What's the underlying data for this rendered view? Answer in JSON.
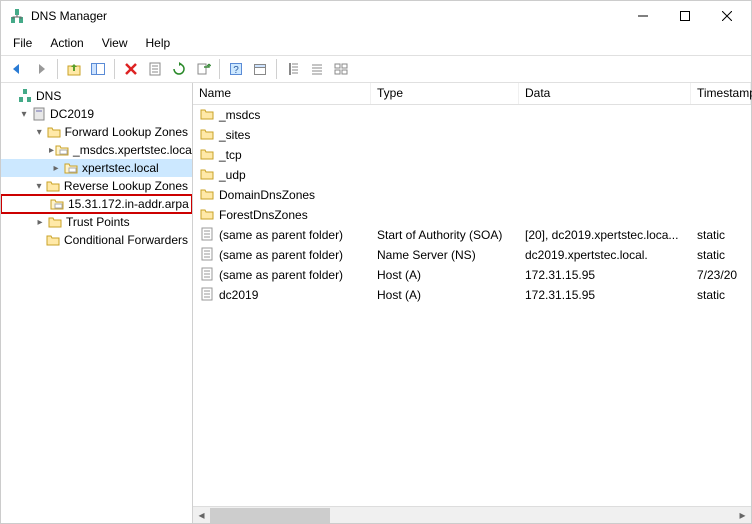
{
  "window": {
    "title": "DNS Manager"
  },
  "menu": {
    "file": "File",
    "action": "Action",
    "view": "View",
    "help": "Help"
  },
  "tree": {
    "root": "DNS",
    "server": "DC2019",
    "flz": "Forward Lookup Zones",
    "flz_child1": "_msdcs.xpertstec.local",
    "flz_child2": "xpertstec.local",
    "rlz": "Reverse Lookup Zones",
    "rlz_child1": "15.31.172.in-addr.arpa",
    "tp": "Trust Points",
    "cf": "Conditional Forwarders"
  },
  "columns": {
    "name": "Name",
    "type": "Type",
    "data": "Data",
    "ts": "Timestamp"
  },
  "rows": [
    {
      "name": "_msdcs",
      "type": "",
      "data": "",
      "ts": "",
      "icon": "folder"
    },
    {
      "name": "_sites",
      "type": "",
      "data": "",
      "ts": "",
      "icon": "folder"
    },
    {
      "name": "_tcp",
      "type": "",
      "data": "",
      "ts": "",
      "icon": "folder"
    },
    {
      "name": "_udp",
      "type": "",
      "data": "",
      "ts": "",
      "icon": "folder"
    },
    {
      "name": "DomainDnsZones",
      "type": "",
      "data": "",
      "ts": "",
      "icon": "folder"
    },
    {
      "name": "ForestDnsZones",
      "type": "",
      "data": "",
      "ts": "",
      "icon": "folder"
    },
    {
      "name": "(same as parent folder)",
      "type": "Start of Authority (SOA)",
      "data": "[20], dc2019.xpertstec.loca...",
      "ts": "static",
      "icon": "record"
    },
    {
      "name": "(same as parent folder)",
      "type": "Name Server (NS)",
      "data": "dc2019.xpertstec.local.",
      "ts": "static",
      "icon": "record"
    },
    {
      "name": "(same as parent folder)",
      "type": "Host (A)",
      "data": "172.31.15.95",
      "ts": "7/23/20",
      "icon": "record"
    },
    {
      "name": "dc2019",
      "type": "Host (A)",
      "data": "172.31.15.95",
      "ts": "static",
      "icon": "record"
    }
  ]
}
